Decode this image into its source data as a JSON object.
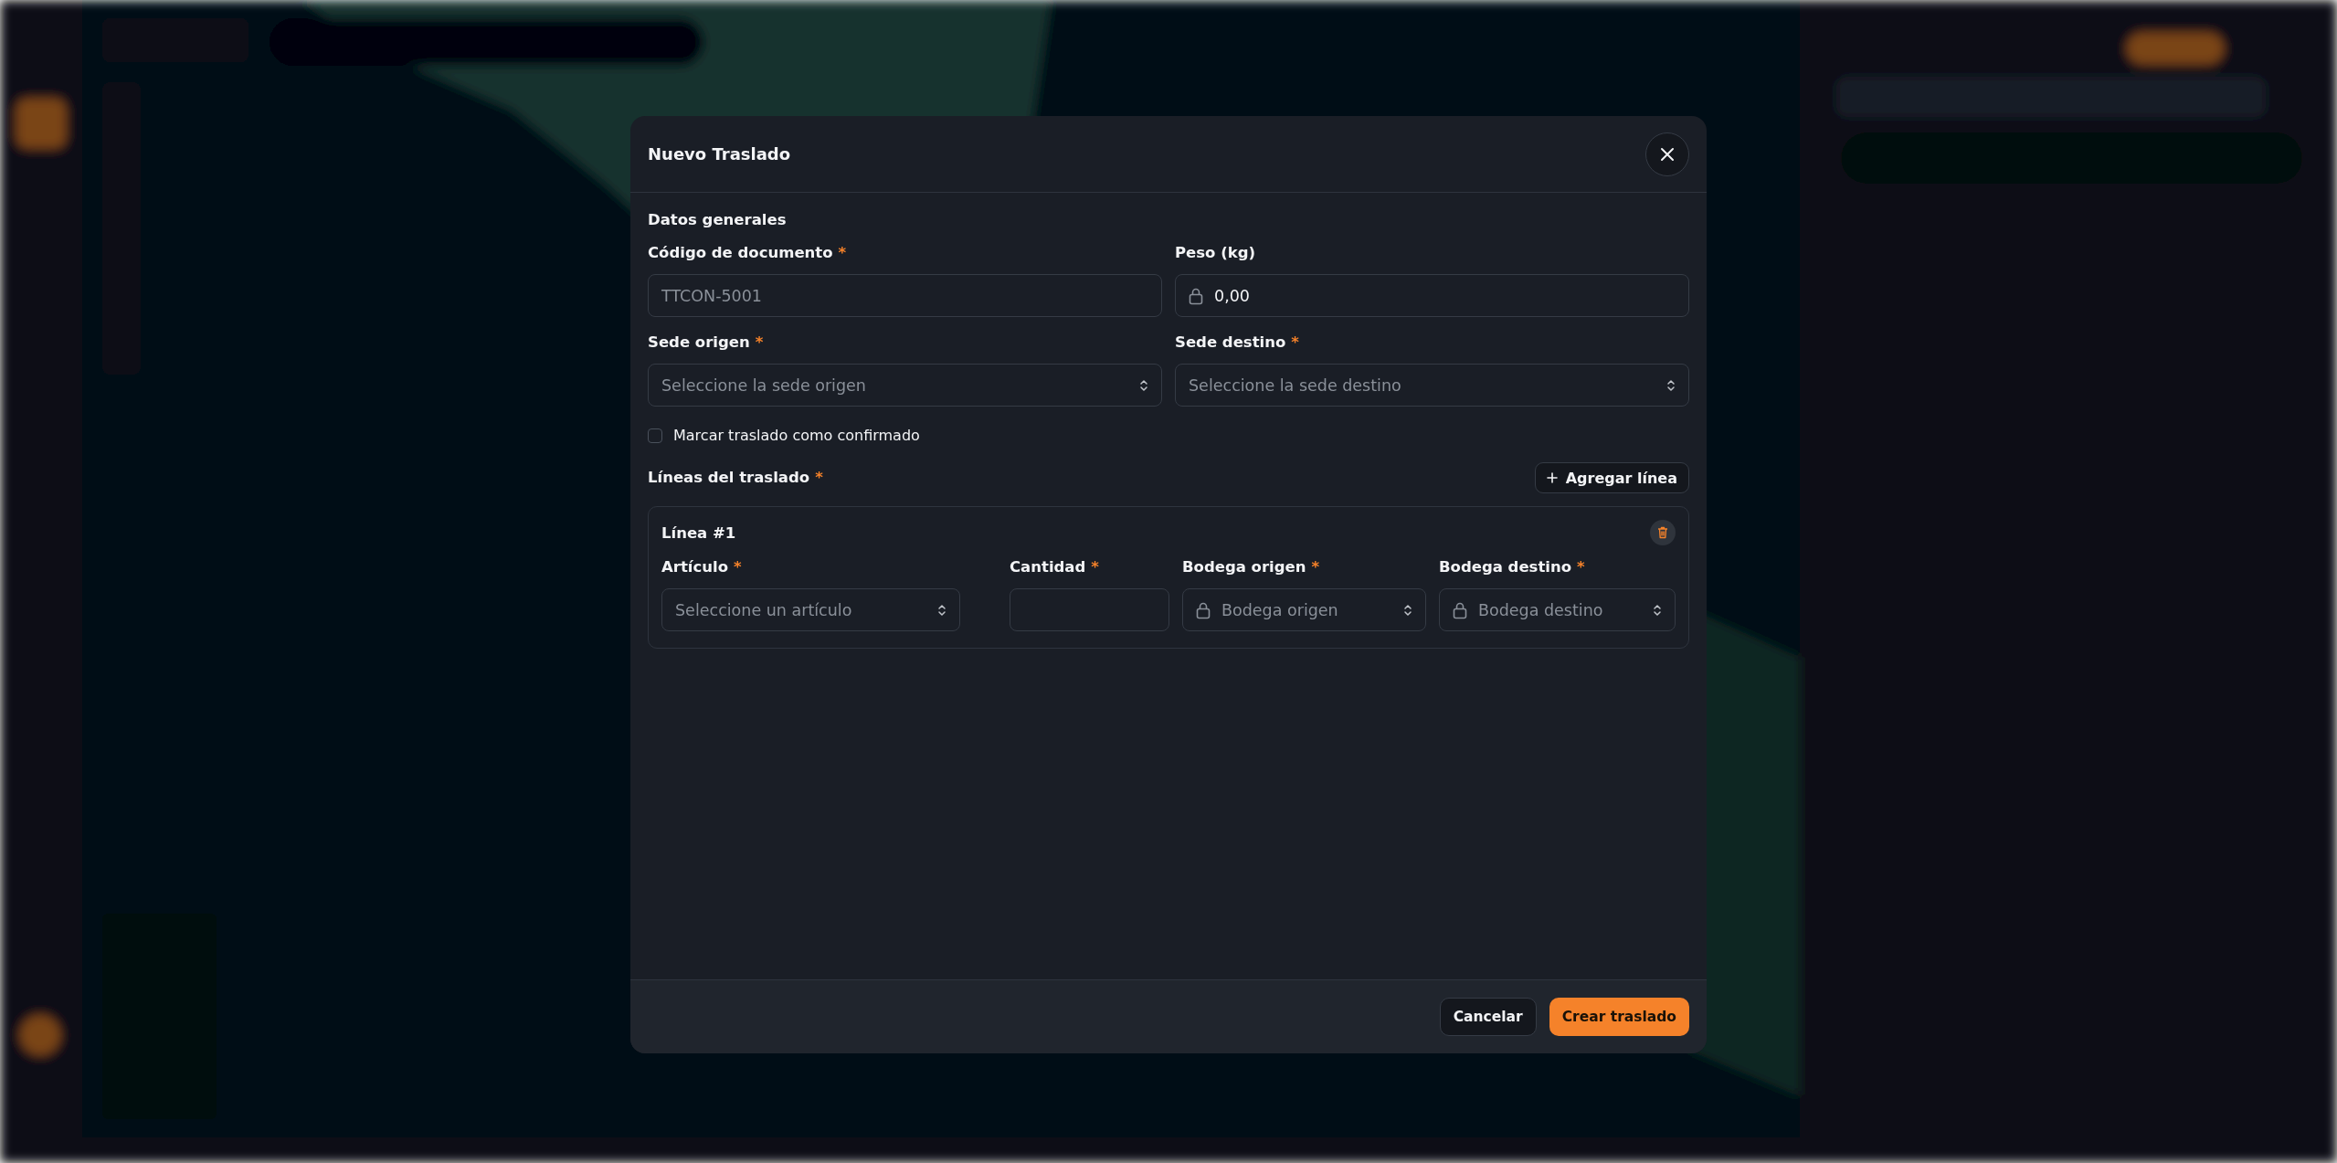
{
  "dialog": {
    "title": "Nuevo Traslado",
    "required_mark": "*",
    "section_title": "Datos generales",
    "fields": [
      {
        "label": "Código de documento",
        "required": true,
        "kind": "text",
        "placeholder": "TTCON-5001"
      },
      {
        "label": "Peso (kg)",
        "required": false,
        "kind": "locked",
        "value": "0,00"
      },
      {
        "label": "Sede origen",
        "required": true,
        "kind": "select",
        "placeholder": "Seleccione la sede origen"
      },
      {
        "label": "Sede destino",
        "required": true,
        "kind": "select",
        "placeholder": "Seleccione la sede destino"
      }
    ],
    "confirm_checkbox": {
      "label": "Marcar traslado como confirmado",
      "checked": false
    },
    "lines_section": {
      "title": "Líneas del traslado",
      "required": true,
      "add_button": "Agregar línea"
    },
    "lines": [
      {
        "title": "Línea #1",
        "fields": [
          {
            "label": "Artículo",
            "required": true,
            "kind": "select",
            "placeholder": "Seleccione un artículo"
          },
          {
            "label": "Cantidad",
            "required": true,
            "kind": "text"
          },
          {
            "label": "Bodega origen",
            "required": true,
            "kind": "locked-select",
            "placeholder": "Bodega origen"
          },
          {
            "label": "Bodega destino",
            "required": true,
            "kind": "locked-select",
            "placeholder": "Bodega destino"
          }
        ]
      }
    ],
    "footer": {
      "cancel": "Cancelar",
      "submit": "Crear traslado"
    }
  }
}
